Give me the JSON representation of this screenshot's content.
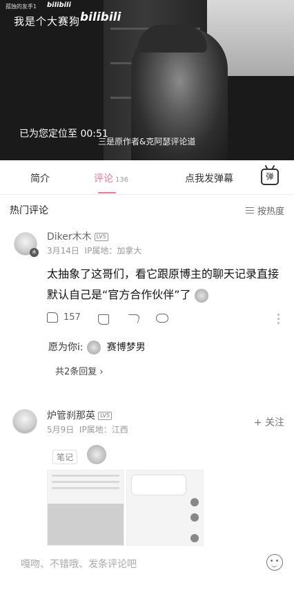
{
  "video": {
    "small_caption": "孤独的友手1",
    "small_logo": "bilibili",
    "title": "我是个大赛狗",
    "logo": "bilibili",
    "seek_toast": "已为您定位至 00:51",
    "subtitle": "三是原作者&克阿瑟评论道"
  },
  "tabs": {
    "intro": "简介",
    "comments": "评论",
    "comments_count": "136",
    "danmaku": "点我发弹幕",
    "danmaku_icon_label": "弹"
  },
  "comments_section": {
    "hot_label": "热门评论",
    "sort_label": "按热度"
  },
  "comment1": {
    "username": "Diker木木",
    "level": "LV5",
    "date": "3月14日",
    "location": "IP属地：加拿大",
    "text": "太抽象了这哥们，看它跟原博主的聊天记录直接默认自己是“官方合作伙伴”了",
    "likes": "157",
    "reply_user": "愿为你i:",
    "reply_text": "赛博梦男",
    "reply_count": "共2条回复 ›"
  },
  "comment2": {
    "username": "炉管刹那英",
    "level": "LV5",
    "date": "5月9日",
    "location": "IP属地：江西",
    "follow": "+ 关注",
    "note_tag": "笔记"
  },
  "bottom_bar": {
    "placeholder": "嘎吻、不错哦、发条评论吧"
  },
  "colors": {
    "accent": "#fb7299"
  }
}
